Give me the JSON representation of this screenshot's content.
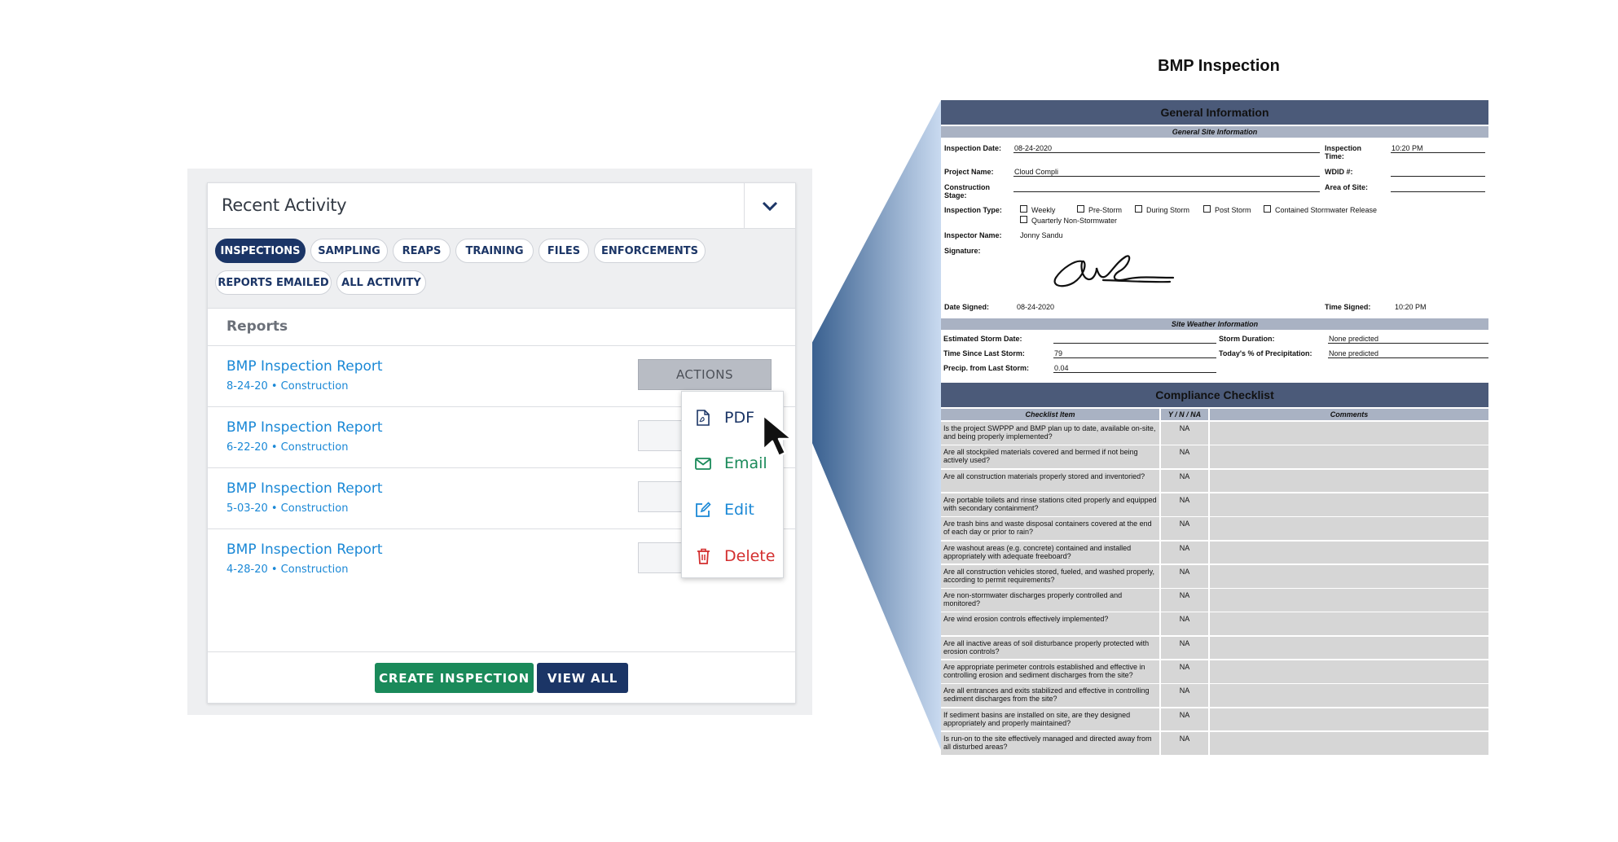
{
  "panel": {
    "title": "Recent Activity",
    "tabs": [
      "INSPECTIONS",
      "SAMPLING",
      "REAPS",
      "TRAINING",
      "FILES",
      "ENFORCEMENTS",
      "REPORTS EMAILED",
      "ALL ACTIVITY"
    ],
    "active_tab": "INSPECTIONS",
    "section_label": "Reports",
    "reports": [
      {
        "title": "BMP Inspection Report",
        "subtitle": "8-24-20 • Construction"
      },
      {
        "title": "BMP Inspection Report",
        "subtitle": "6-22-20 • Construction"
      },
      {
        "title": "BMP Inspection Report",
        "subtitle": "5-03-20 • Construction"
      },
      {
        "title": "BMP Inspection Report",
        "subtitle": "4-28-20 • Construction"
      }
    ],
    "actions_label": "ACTIONS",
    "menu": [
      {
        "label": "PDF",
        "icon": "pdf-file-icon",
        "color": "#1b3566"
      },
      {
        "label": "Email",
        "icon": "envelope-icon",
        "color": "#1a8a5a"
      },
      {
        "label": "Edit",
        "icon": "edit-icon",
        "color": "#1a88d6"
      },
      {
        "label": "Delete",
        "icon": "trash-icon",
        "color": "#d32f2f"
      }
    ],
    "create_label": "CREATE INSPECTION",
    "view_all_label": "VIEW ALL"
  },
  "doc": {
    "title": "BMP Inspection",
    "general_header": "General Information",
    "site_sub": "General Site Information",
    "inspection_date_label": "Inspection Date:",
    "inspection_date": "08-24-2020",
    "inspection_time_label": "Inspection Time:",
    "inspection_time": "10:20 PM",
    "project_name_label": "Project Name:",
    "project_name": "Cloud Compli",
    "wdid_label": "WDID #:",
    "construction_stage_label": "Construction Stage:",
    "area_label": "Area of Site:",
    "inspection_type_label": "Inspection Type:",
    "inspection_types": [
      "Weekly",
      "Pre-Storm",
      "During Storm",
      "Post Storm",
      "Contained Stormwater Release",
      "Quarterly Non-Stormwater"
    ],
    "inspector_label": "Inspector Name:",
    "inspector_name": "Jonny Sandu",
    "signature_label": "Signature:",
    "date_signed_label": "Date Signed:",
    "date_signed": "08-24-2020",
    "time_signed_label": "Time Signed:",
    "time_signed": "10:20 PM",
    "weather_sub": "Site Weather Information",
    "storm_date_label": "Estimated Storm Date:",
    "storm_duration_label": "Storm Duration:",
    "storm_duration": "None predicted",
    "time_since_label": "Time Since Last Storm:",
    "time_since": "79",
    "precip_pct_label": "Today's % of Precipitation:",
    "precip_pct": "None predicted",
    "precip_last_label": "Precip. from Last Storm:",
    "precip_last": "0.04",
    "compliance_header": "Compliance Checklist",
    "col_item": "Checklist Item",
    "col_yn": "Y / N / NA",
    "col_comments": "Comments",
    "checklist": [
      {
        "q": "Is the project SWPPP and BMP plan up to date, available on-site, and being properly implemented?",
        "a": "NA"
      },
      {
        "q": "Are all stockpiled materials covered and bermed if not being actively used?",
        "a": "NA"
      },
      {
        "q": "Are all construction materials properly stored and inventoried?",
        "a": "NA"
      },
      {
        "q": "Are portable toilets and rinse stations cited properly and equipped with secondary containment?",
        "a": "NA"
      },
      {
        "q": "Are trash bins and waste disposal containers covered at the end of each day or prior to rain?",
        "a": "NA"
      },
      {
        "q": "Are washout areas (e.g. concrete) contained and installed appropriately with adequate freeboard?",
        "a": "NA"
      },
      {
        "q": "Are all construction vehicles stored, fueled, and washed properly, according to permit requirements?",
        "a": "NA"
      },
      {
        "q": "Are non-stormwater discharges properly controlled and monitored?",
        "a": "NA"
      },
      {
        "q": "Are wind erosion controls effectively implemented?",
        "a": "NA"
      },
      {
        "q": "Are all inactive areas of soil disturbance properly protected with erosion controls?",
        "a": "NA"
      },
      {
        "q": "Are appropriate perimeter controls established and effective in controlling erosion and sediment discharges from the site?",
        "a": "NA"
      },
      {
        "q": "Are all entrances and exits stabilized and effective in controlling sediment discharges from the site?",
        "a": "NA"
      },
      {
        "q": "If sediment basins are installed on site, are they designed appropriately and properly maintained?",
        "a": "NA"
      },
      {
        "q": "Is run-on to the site effectively managed and directed away from all disturbed areas?",
        "a": "NA"
      }
    ]
  }
}
